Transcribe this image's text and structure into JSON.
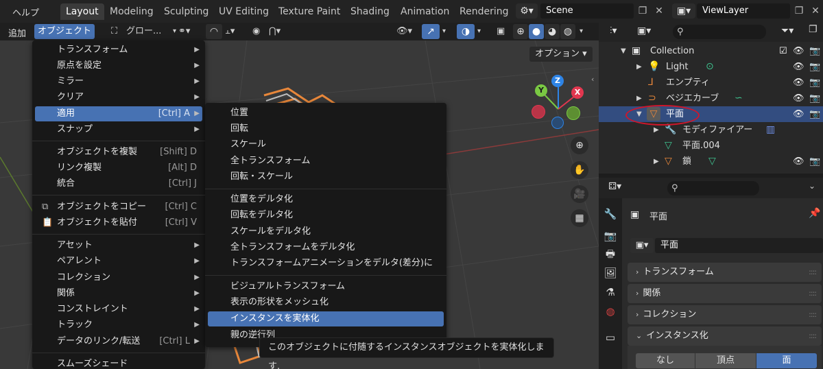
{
  "topbar": {
    "help_menu": "ヘルプ",
    "workspaces": [
      "Layout",
      "Modeling",
      "Sculpting",
      "UV Editing",
      "Texture Paint",
      "Shading",
      "Animation",
      "Rendering"
    ],
    "active_workspace": "Layout",
    "scene_name": "Scene",
    "view_layer": "ViewLayer"
  },
  "header": {
    "add_menu": "追加",
    "object_menu": "オブジェクト",
    "transform_orientation": "グロー...",
    "viewport_options": "オプション"
  },
  "gizmo": {
    "z": "Z",
    "y": "Y",
    "x": "X"
  },
  "object_menu": {
    "items": [
      {
        "label": "トランスフォーム",
        "shortcut": "",
        "submenu": true
      },
      {
        "label": "原点を設定",
        "shortcut": "",
        "submenu": true
      },
      {
        "label": "ミラー",
        "shortcut": "",
        "submenu": true
      },
      {
        "label": "クリア",
        "shortcut": "",
        "submenu": true
      },
      {
        "label": "適用",
        "shortcut": "[Ctrl] A",
        "submenu": true,
        "highlighted": true
      },
      {
        "label": "スナップ",
        "shortcut": "",
        "submenu": true
      },
      {
        "label": "オブジェクトを複製",
        "shortcut": "[Shift] D"
      },
      {
        "label": "リンク複製",
        "shortcut": "[Alt] D"
      },
      {
        "label": "統合",
        "shortcut": "[Ctrl] J"
      },
      {
        "label": "オブジェクトをコピー",
        "shortcut": "[Ctrl] C"
      },
      {
        "label": "オブジェクトを貼付",
        "shortcut": "[Ctrl] V"
      },
      {
        "label": "アセット",
        "shortcut": "",
        "submenu": true
      },
      {
        "label": "ペアレント",
        "shortcut": "",
        "submenu": true
      },
      {
        "label": "コレクション",
        "shortcut": "",
        "submenu": true
      },
      {
        "label": "関係",
        "shortcut": "",
        "submenu": true
      },
      {
        "label": "コンストレイント",
        "shortcut": "",
        "submenu": true
      },
      {
        "label": "トラック",
        "shortcut": "",
        "submenu": true
      },
      {
        "label": "データのリンク/転送",
        "shortcut": "[Ctrl] L"
      },
      {
        "label": "スムーズシェード",
        "shortcut": ""
      }
    ]
  },
  "apply_submenu": {
    "items": [
      "位置",
      "回転",
      "スケール",
      "全トランスフォーム",
      "回転・スケール",
      "位置をデルタ化",
      "回転をデルタ化",
      "スケールをデルタ化",
      "全トランスフォームをデルタ化",
      "トランスフォームアニメーションをデルタ(差分)に",
      "ビジュアルトランスフォーム",
      "表示の形状をメッシュ化",
      "インスタンスを実体化",
      "親の逆行列"
    ],
    "highlighted": "インスタンスを実体化"
  },
  "tooltip": "このオブジェクトに付随するインスタンスオブジェクトを実体化します.",
  "outliner": {
    "rows": [
      {
        "label": "Collection"
      },
      {
        "label": "Light"
      },
      {
        "label": "エンプティ"
      },
      {
        "label": "ベジエカーブ"
      },
      {
        "label": "平面",
        "selected": true
      },
      {
        "label": "モディファイアー"
      },
      {
        "label": "平面.004"
      },
      {
        "label": "鎖"
      }
    ]
  },
  "properties": {
    "object_name": "平面",
    "datablock_name": "平面",
    "panels": [
      "トランスフォーム",
      "関係",
      "コレクション",
      "インスタンス化"
    ],
    "instancing_options": [
      "なし",
      "頂点",
      "面"
    ],
    "instancing_active": "面"
  },
  "colors": {
    "accent": "#4772b3",
    "selection": "#334d80",
    "object_orange": "#e8873a",
    "annotation_red": "#d0162a",
    "axis_x": "#e2374f",
    "axis_y": "#7ac943",
    "axis_z": "#2e84e6"
  }
}
